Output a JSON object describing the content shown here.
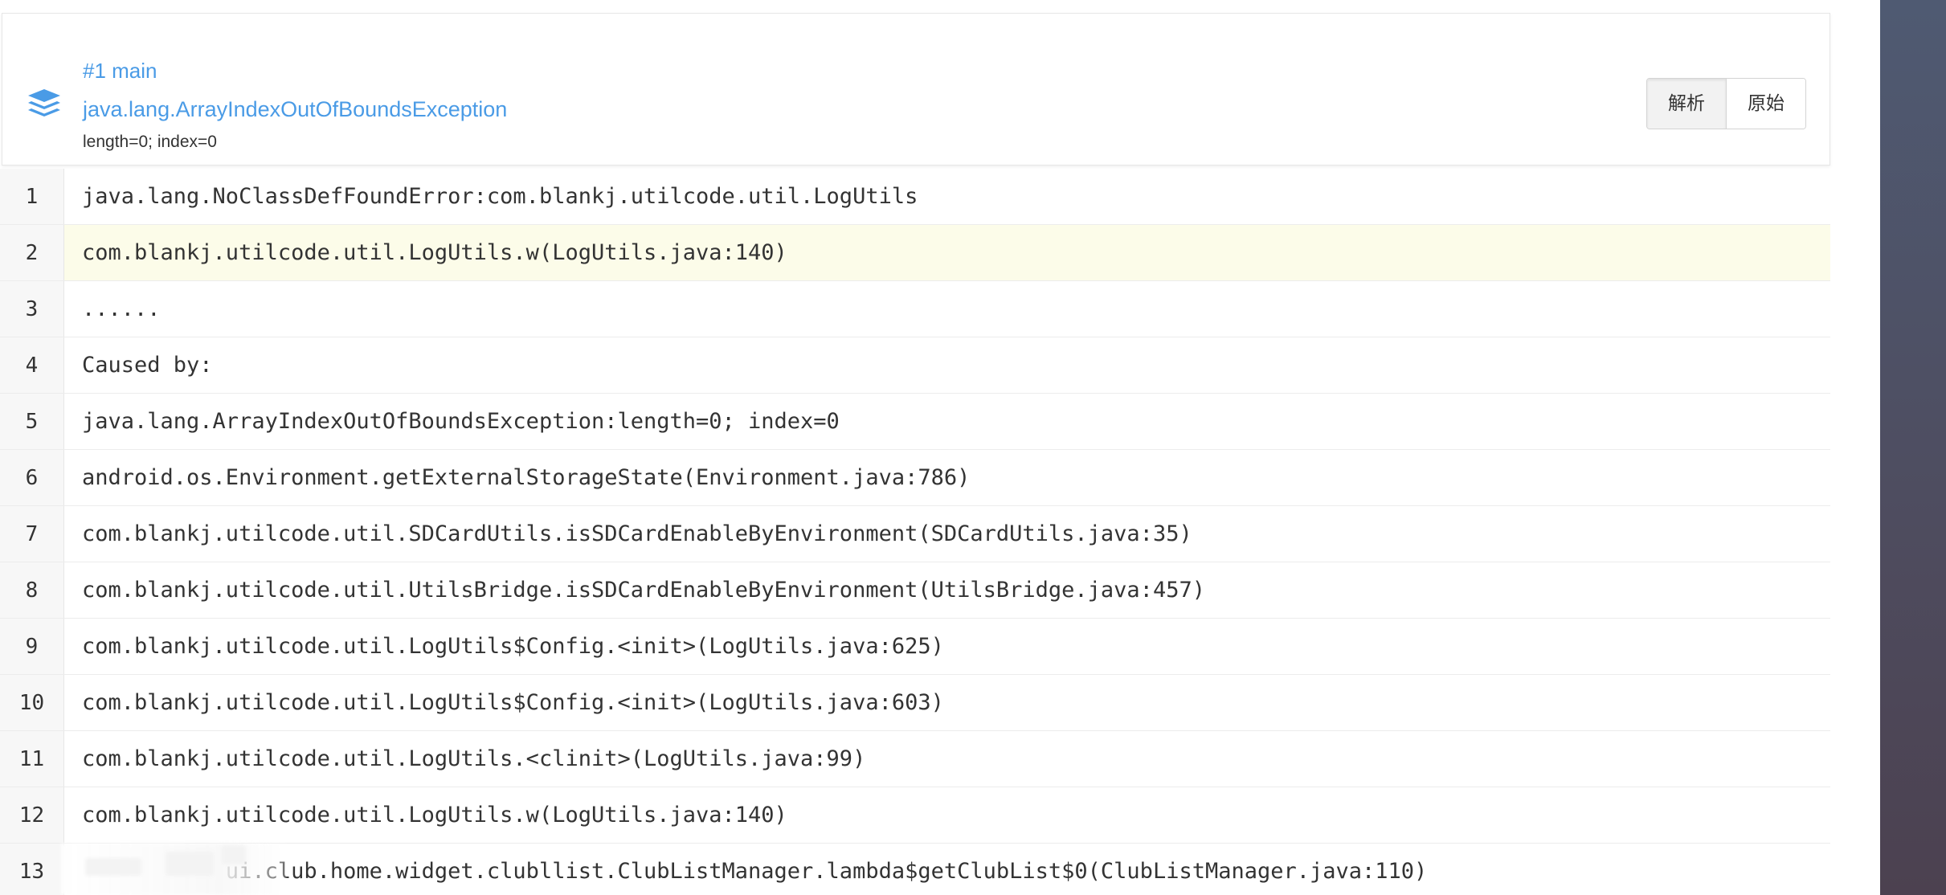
{
  "header": {
    "thread": "#1 main",
    "exception": "java.lang.ArrayIndexOutOfBoundsException",
    "message": "length=0; index=0",
    "buttons": {
      "parsed": "解析",
      "raw": "原始"
    }
  },
  "stacktrace": [
    {
      "no": "1",
      "text": "java.lang.NoClassDefFoundError:com.blankj.utilcode.util.LogUtils"
    },
    {
      "no": "2",
      "text": "com.blankj.utilcode.util.LogUtils.w(LogUtils.java:140)"
    },
    {
      "no": "3",
      "text": "......"
    },
    {
      "no": "4",
      "text": "Caused by:"
    },
    {
      "no": "5",
      "text": "java.lang.ArrayIndexOutOfBoundsException:length=0; index=0"
    },
    {
      "no": "6",
      "text": "android.os.Environment.getExternalStorageState(Environment.java:786)"
    },
    {
      "no": "7",
      "text": "com.blankj.utilcode.util.SDCardUtils.isSDCardEnableByEnvironment(SDCardUtils.java:35)"
    },
    {
      "no": "8",
      "text": "com.blankj.utilcode.util.UtilsBridge.isSDCardEnableByEnvironment(UtilsBridge.java:457)"
    },
    {
      "no": "9",
      "text": "com.blankj.utilcode.util.LogUtils$Config.<init>(LogUtils.java:625)"
    },
    {
      "no": "10",
      "text": "com.blankj.utilcode.util.LogUtils$Config.<init>(LogUtils.java:603)"
    },
    {
      "no": "11",
      "text": "com.blankj.utilcode.util.LogUtils.<clinit>(LogUtils.java:99)"
    },
    {
      "no": "12",
      "text": "com.blankj.utilcode.util.LogUtils.w(LogUtils.java:140)"
    },
    {
      "no": "13",
      "text": "           ui.club.home.widget.clubllist.ClubListManager.lambda$getClubList$0(ClubListManager.java:110)"
    }
  ],
  "colors": {
    "accent": "#4a9be6",
    "highlight_row": "#fcfce9",
    "panel_top": "#4f5a72",
    "panel_bottom": "#4c4150"
  },
  "icons": {
    "header": "layers-icon"
  }
}
